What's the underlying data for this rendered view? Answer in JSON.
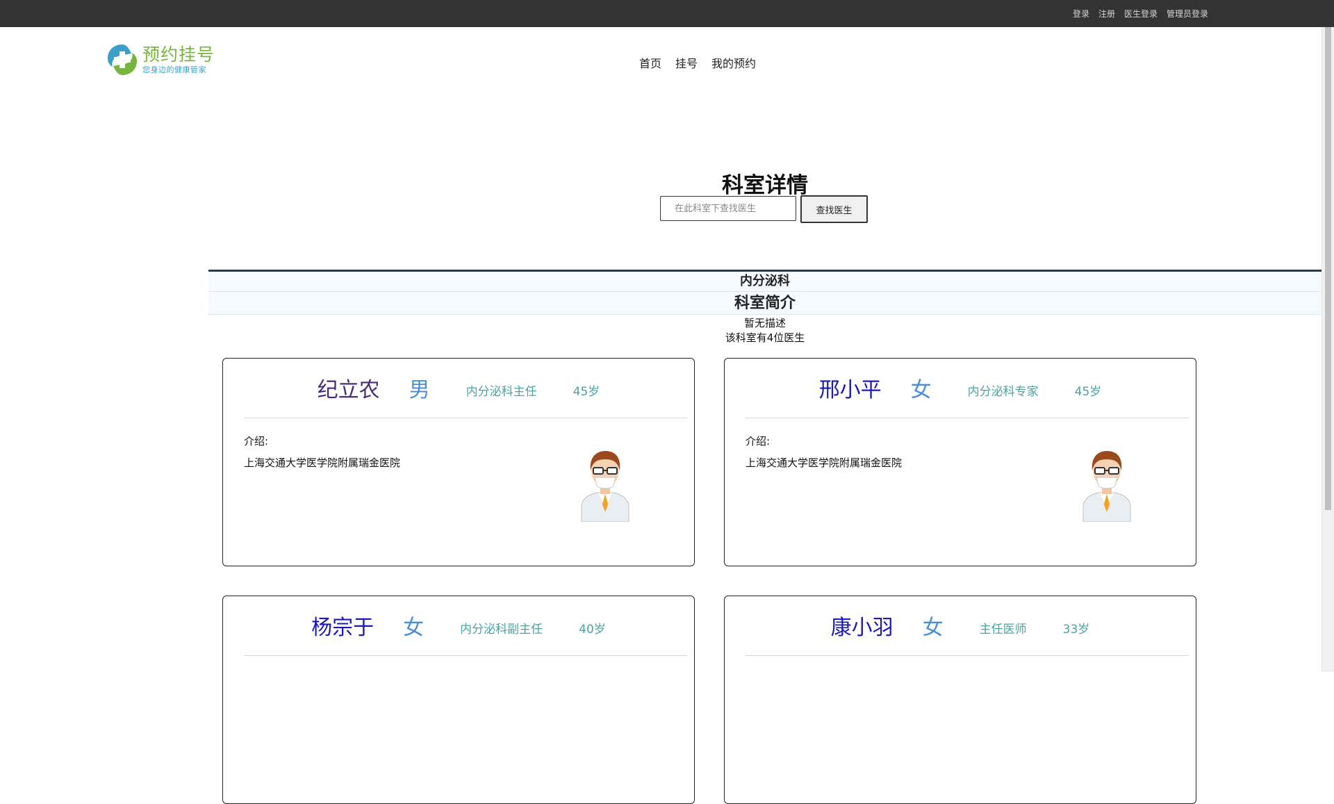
{
  "topbar": {
    "links": [
      "登录",
      "注册",
      "医生登录",
      "管理员登录"
    ]
  },
  "brand": {
    "title": "预约挂号",
    "subtitle": "您身边的健康管家",
    "colors": {
      "green": "#76b63e",
      "blue": "#3a9fc9"
    }
  },
  "nav": {
    "items": [
      "首页",
      "挂号",
      "我的预约"
    ]
  },
  "page": {
    "title": "科室详情"
  },
  "search": {
    "placeholder": "在此科室下查找医生",
    "button_label": "查找医生"
  },
  "department": {
    "name": "内分泌科",
    "intro_heading": "科室简介",
    "description": "暂无描述",
    "doctor_count_text": "该科室有4位医生"
  },
  "doctors": [
    {
      "name": "纪立农",
      "gender": "男",
      "title": "内分泌科主任",
      "age": "45岁",
      "intro_label": "介绍:",
      "intro": "上海交通大学医学院附属瑞金医院"
    },
    {
      "name": "邢小平",
      "gender": "女",
      "title": "内分泌科专家",
      "age": "45岁",
      "intro_label": "介绍:",
      "intro": "上海交通大学医学院附属瑞金医院"
    },
    {
      "name": "杨宗于",
      "gender": "女",
      "title": "内分泌科副主任",
      "age": "40岁"
    },
    {
      "name": "康小羽",
      "gender": "女",
      "title": "主任医师",
      "age": "33岁"
    }
  ],
  "icons": [
    "logo-mark",
    "doctor-avatar-icon"
  ]
}
